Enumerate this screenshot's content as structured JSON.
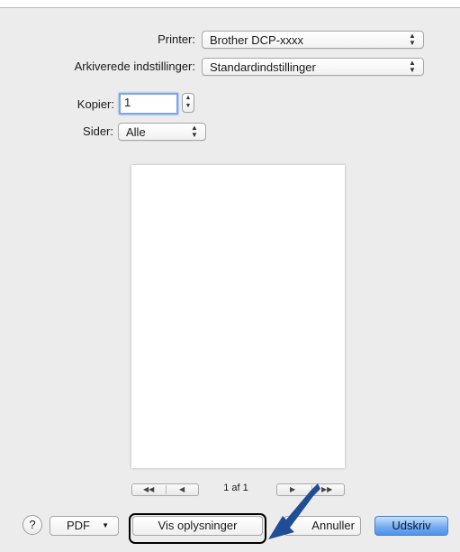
{
  "form": {
    "printer_label": "Printer:",
    "printer_value": "Brother DCP-xxxx",
    "presets_label": "Arkiverede indstillinger:",
    "presets_value": "Standardindstillinger",
    "copies_label": "Kopier:",
    "copies_value": "1",
    "pages_label": "Sider:",
    "pages_value": "Alle"
  },
  "preview": {
    "page_indicator": "1 af 1"
  },
  "buttons": {
    "help": "?",
    "pdf": "PDF",
    "details": "Vis oplysninger",
    "cancel": "Annuller",
    "print": "Udskriv"
  },
  "icons": {
    "popup_arrows": "updown-arrows-icon",
    "first_page": "first-page-icon",
    "prev_page": "previous-page-icon",
    "next_page": "next-page-icon",
    "last_page": "last-page-icon",
    "callout_arrow": "callout-arrow-icon"
  },
  "colors": {
    "dialog_bg": "#ececec",
    "default_button": "#4f93ea",
    "focus_ring": "#7aa7e8",
    "callout_arrow": "#1f4e96"
  }
}
